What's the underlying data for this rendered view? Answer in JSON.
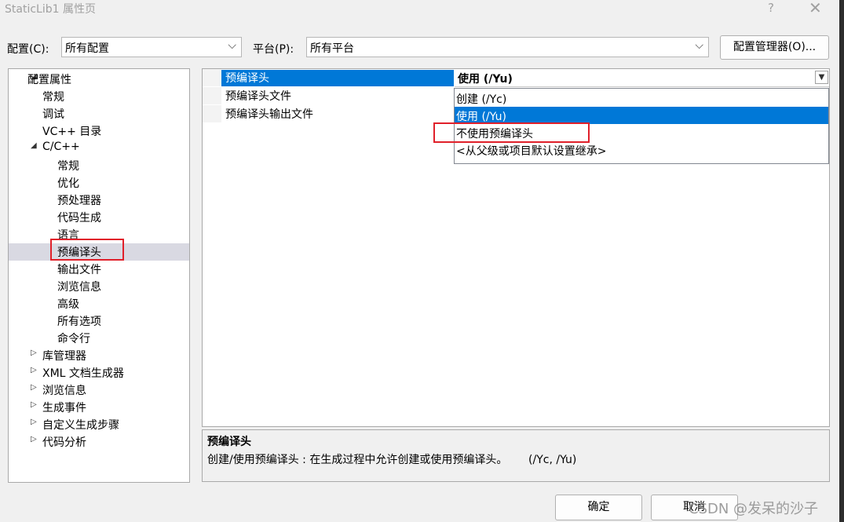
{
  "window": {
    "title": "StaticLib1 属性页",
    "help_label": "?",
    "close_label": "✕"
  },
  "config": {
    "config_label": "配置(C):",
    "config_value": "所有配置",
    "platform_label": "平台(P):",
    "platform_value": "所有平台",
    "manager_button": "配置管理器(O)..."
  },
  "tree": {
    "items": [
      {
        "label": "配置属性",
        "arrow": "◢"
      },
      {
        "label": "常规"
      },
      {
        "label": "调试"
      },
      {
        "label": "VC++ 目录"
      },
      {
        "label": "C/C++",
        "arrow": "◢"
      },
      {
        "label": "常规"
      },
      {
        "label": "优化"
      },
      {
        "label": "预处理器"
      },
      {
        "label": "代码生成"
      },
      {
        "label": "语言"
      },
      {
        "label": "预编译头"
      },
      {
        "label": "输出文件"
      },
      {
        "label": "浏览信息"
      },
      {
        "label": "高级"
      },
      {
        "label": "所有选项"
      },
      {
        "label": "命令行"
      },
      {
        "label": "库管理器",
        "arrow": "▷"
      },
      {
        "label": "XML 文档生成器",
        "arrow": "▷"
      },
      {
        "label": "浏览信息",
        "arrow": "▷"
      },
      {
        "label": "生成事件",
        "arrow": "▷"
      },
      {
        "label": "自定义生成步骤",
        "arrow": "▷"
      },
      {
        "label": "代码分析",
        "arrow": "▷"
      }
    ]
  },
  "properties": {
    "rows": [
      {
        "name": "预编译头",
        "value": "使用 (/Yu)"
      },
      {
        "name": "预编译头文件"
      },
      {
        "name": "预编译头输出文件"
      }
    ],
    "dropdown_icon": "chevron-down-icon",
    "dropdown_options": [
      "创建 (/Yc)",
      "使用 (/Yu)",
      "不使用预编译头",
      "<从父级或项目默认设置继承>"
    ],
    "selected_option": "使用 (/Yu)"
  },
  "description": {
    "title": "预编译头",
    "text": "创建/使用预编译头 : 在生成过程中允许创建或使用预编译头。      (/Yc, /Yu)"
  },
  "buttons": {
    "ok": "确定",
    "cancel": "取消"
  },
  "watermark": "CSDN @发呆的沙子",
  "colors": {
    "selection": "#0078d7",
    "highlight_box": "#e0202a",
    "tree_selected": "#d9d9e2"
  }
}
